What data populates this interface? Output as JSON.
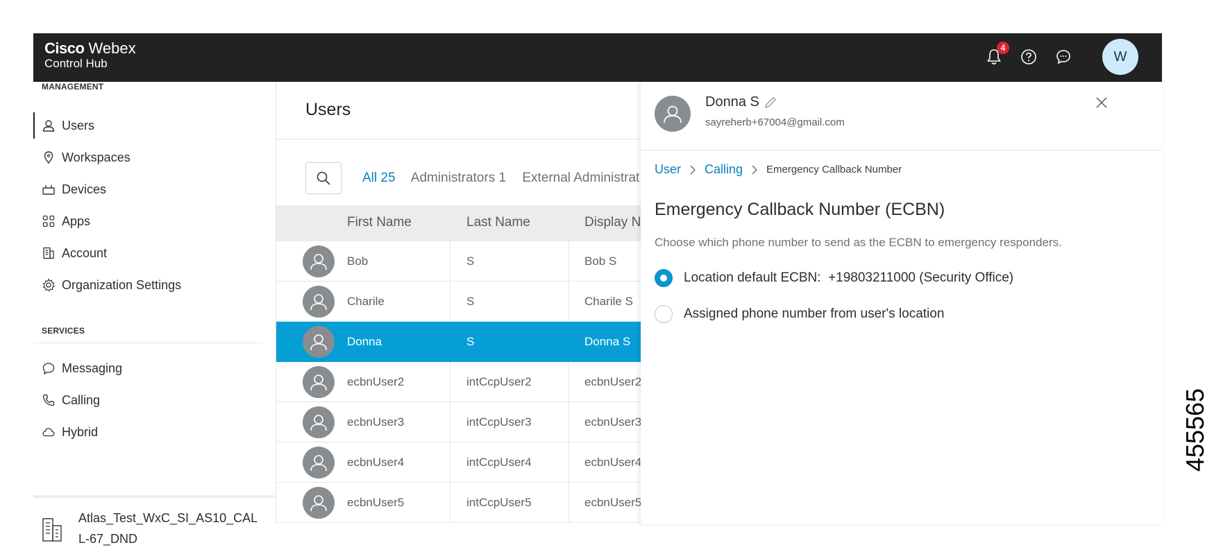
{
  "header": {
    "brand_bold": "Cisco",
    "brand_light": "Webex",
    "product": "Control Hub",
    "notification_count": "4",
    "avatar_initial": "W",
    "icons": [
      "bell-icon",
      "help-icon",
      "chat-icon"
    ]
  },
  "sidebar": {
    "management_label": "MANAGEMENT",
    "management_items": [
      {
        "label": "Users",
        "icon": "user-icon",
        "active": true
      },
      {
        "label": "Workspaces",
        "icon": "location-pin-icon"
      },
      {
        "label": "Devices",
        "icon": "device-icon"
      },
      {
        "label": "Apps",
        "icon": "apps-grid-icon"
      },
      {
        "label": "Account",
        "icon": "account-icon"
      },
      {
        "label": "Organization Settings",
        "icon": "gear-icon"
      }
    ],
    "services_label": "SERVICES",
    "services_items": [
      {
        "label": "Messaging",
        "icon": "message-bubble-icon"
      },
      {
        "label": "Calling",
        "icon": "phone-icon"
      },
      {
        "label": "Hybrid",
        "icon": "cloud-icon"
      }
    ],
    "organization": "Atlas_Test_WxC_SI_AS10_CALL-67_DND"
  },
  "users": {
    "title": "Users",
    "filters": [
      {
        "label": "All 25",
        "active": true
      },
      {
        "label": "Administrators 1"
      },
      {
        "label": "External Administrators"
      }
    ],
    "columns": [
      "First Name",
      "Last Name",
      "Display Na"
    ],
    "rows": [
      {
        "first": "Bob",
        "last": "S",
        "display": "Bob S"
      },
      {
        "first": "Charile",
        "last": "S",
        "display": "Charile S"
      },
      {
        "first": "Donna",
        "last": "S",
        "display": "Donna S",
        "selected": true
      },
      {
        "first": "ecbnUser2",
        "last": "intCcpUser2",
        "display": "ecbnUser2"
      },
      {
        "first": "ecbnUser3",
        "last": "intCcpUser3",
        "display": "ecbnUser3"
      },
      {
        "first": "ecbnUser4",
        "last": "intCcpUser4",
        "display": "ecbnUser4"
      },
      {
        "first": "ecbnUser5",
        "last": "intCcpUser5",
        "display": "ecbnUser5"
      }
    ]
  },
  "detail": {
    "name": "Donna S",
    "email": "sayreherb+67004@gmail.com",
    "breadcrumb": {
      "user": "User",
      "calling": "Calling",
      "current": "Emergency Callback Number"
    },
    "title": "Emergency Callback Number (ECBN)",
    "description": "Choose which phone number to send as the ECBN to emergency responders.",
    "options": [
      {
        "label": "Location default ECBN:  +19803211000 (Security Office)",
        "selected": true
      },
      {
        "label": "Assigned phone number from user's location",
        "selected": false
      }
    ]
  },
  "figure_id": "455565",
  "colors": {
    "accent": "#059fd6",
    "link": "#0b7fc1",
    "header": "#222222",
    "badge": "#e0232d"
  }
}
